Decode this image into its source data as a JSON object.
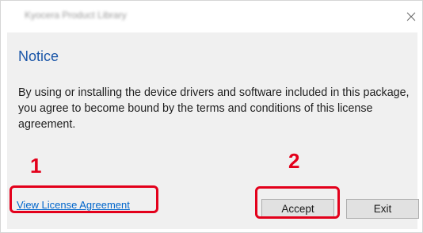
{
  "window": {
    "title": "Kyocera Product Library",
    "close_icon": "close-icon"
  },
  "notice": {
    "heading": "Notice",
    "body": "By using or installing the device drivers and software included in this package, you agree to become bound by the terms and conditions of this license agreement."
  },
  "links": {
    "view_license": "View License Agreement"
  },
  "buttons": {
    "accept": "Accept",
    "exit": "Exit"
  },
  "annotations": {
    "step1": "1",
    "step2": "2",
    "highlight_color": "#e3001b"
  },
  "colors": {
    "heading": "#1a56a8",
    "link": "#0066cc",
    "panel_bg": "#f0f0f0"
  }
}
